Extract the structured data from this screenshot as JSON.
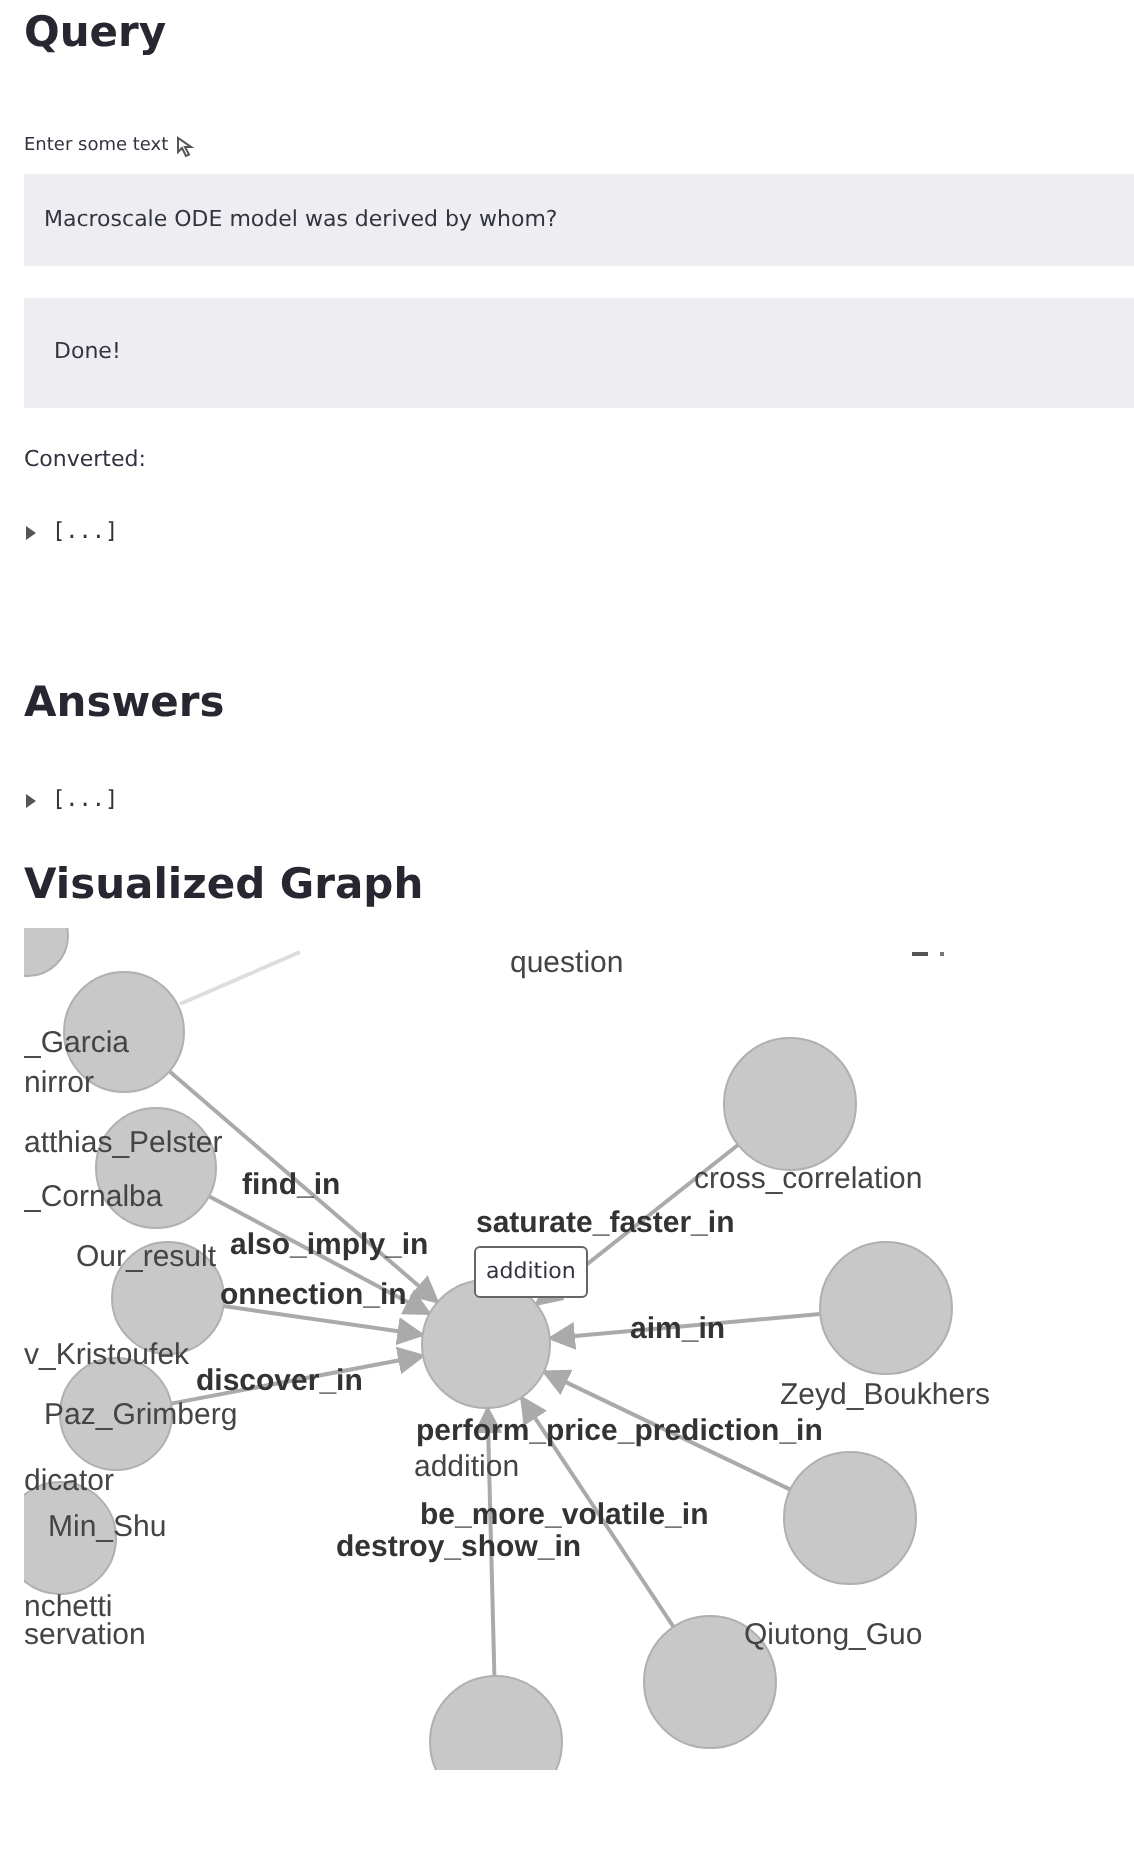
{
  "query": {
    "heading": "Query",
    "field_label": "Enter some text",
    "value": "Macroscale ODE model was derived by whom?",
    "status": "Done!",
    "converted_label": "Converted:",
    "converted_expander": {
      "text": "[...]",
      "expanded": false
    }
  },
  "answers": {
    "heading": "Answers",
    "expander": {
      "text": "[...]",
      "expanded": false
    }
  },
  "graph": {
    "heading": "Visualized Graph",
    "tooltip": "addition",
    "labels": [
      {
        "kind": "node",
        "text": "question"
      },
      {
        "kind": "node",
        "text": "_Garcia"
      },
      {
        "kind": "node",
        "text": "nirror"
      },
      {
        "kind": "node",
        "text": "atthias_Pelster"
      },
      {
        "kind": "node",
        "text": "_Cornalba"
      },
      {
        "kind": "node",
        "text": "Our_result"
      },
      {
        "kind": "node",
        "text": "v_Kristoufek"
      },
      {
        "kind": "node",
        "text": "Paz_Grimberg"
      },
      {
        "kind": "node",
        "text": "dicator"
      },
      {
        "kind": "node",
        "text": "Min_Shu"
      },
      {
        "kind": "node",
        "text": "nchetti"
      },
      {
        "kind": "node",
        "text": "servation"
      },
      {
        "kind": "node",
        "text": "cross_correlation"
      },
      {
        "kind": "node",
        "text": "Zeyd_Boukhers"
      },
      {
        "kind": "node",
        "text": "Qiutong_Guo"
      },
      {
        "kind": "node",
        "text": "addition"
      },
      {
        "kind": "edge",
        "text": "find_in"
      },
      {
        "kind": "edge",
        "text": "also_imply_in"
      },
      {
        "kind": "edge",
        "text": "onnection_in"
      },
      {
        "kind": "edge",
        "text": "saturate_faster_in"
      },
      {
        "kind": "edge",
        "text": "aim_in"
      },
      {
        "kind": "edge",
        "text": "discover_in"
      },
      {
        "kind": "edge",
        "text": "perform_price_prediction_in"
      },
      {
        "kind": "edge",
        "text": "be_more_volatile_in"
      },
      {
        "kind": "edge",
        "text": "destroy_show_in"
      }
    ]
  }
}
